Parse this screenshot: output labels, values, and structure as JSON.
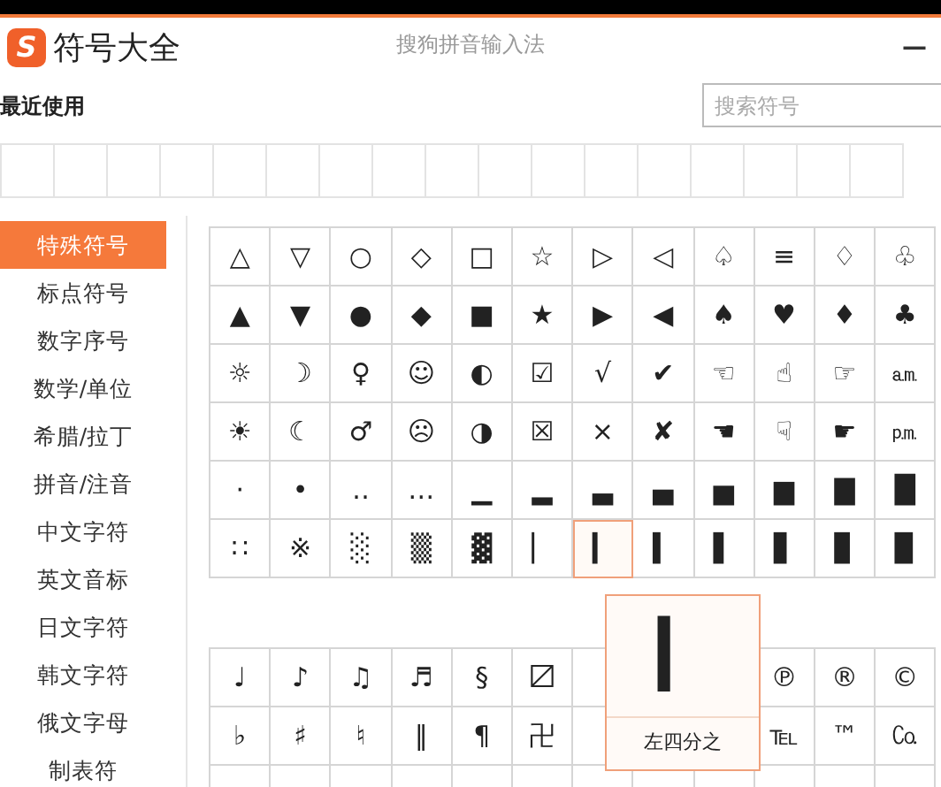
{
  "window": {
    "logo_letter": "S",
    "title": "符号大全",
    "app_name": "搜狗拼音输入法",
    "minimize": "—"
  },
  "recent": {
    "label": "最近使用",
    "search": {
      "placeholder": "搜索符号"
    }
  },
  "sidebar": {
    "items": [
      {
        "label": "特殊符号",
        "selected": true
      },
      {
        "label": "标点符号",
        "selected": false
      },
      {
        "label": "数字序号",
        "selected": false
      },
      {
        "label": "数学/单位",
        "selected": false
      },
      {
        "label": "希腊/拉丁",
        "selected": false
      },
      {
        "label": "拼音/注音",
        "selected": false
      },
      {
        "label": "中文字符",
        "selected": false
      },
      {
        "label": "英文音标",
        "selected": false
      },
      {
        "label": "日文字符",
        "selected": false
      },
      {
        "label": "韩文字符",
        "selected": false
      },
      {
        "label": "俄文字母",
        "selected": false
      },
      {
        "label": "制表符",
        "selected": false
      }
    ]
  },
  "grids": [
    {
      "rows": [
        {
          "cells": [
            {
              "symbol": "△",
              "hovered": false
            },
            {
              "symbol": "▽",
              "hovered": false
            },
            {
              "symbol": "○",
              "hovered": false
            },
            {
              "symbol": "◇",
              "hovered": false
            },
            {
              "symbol": "□",
              "hovered": false
            },
            {
              "symbol": "☆",
              "hovered": false
            },
            {
              "symbol": "▷",
              "hovered": false
            },
            {
              "symbol": "◁",
              "hovered": false
            },
            {
              "symbol": "♤",
              "hovered": false
            },
            {
              "symbol": "≡",
              "hovered": false
            },
            {
              "symbol": "♢",
              "hovered": false
            },
            {
              "symbol": "♧",
              "hovered": false
            }
          ]
        },
        {
          "cells": [
            {
              "symbol": "▲",
              "hovered": false
            },
            {
              "symbol": "▼",
              "hovered": false
            },
            {
              "symbol": "●",
              "hovered": false
            },
            {
              "symbol": "◆",
              "hovered": false
            },
            {
              "symbol": "■",
              "hovered": false
            },
            {
              "symbol": "★",
              "hovered": false
            },
            {
              "symbol": "▶",
              "hovered": false
            },
            {
              "symbol": "◀",
              "hovered": false
            },
            {
              "symbol": "♠",
              "hovered": false
            },
            {
              "symbol": "♥",
              "hovered": false
            },
            {
              "symbol": "♦",
              "hovered": false
            },
            {
              "symbol": "♣",
              "hovered": false
            }
          ]
        },
        {
          "cells": [
            {
              "symbol": "☼",
              "hovered": false
            },
            {
              "symbol": "☽",
              "hovered": false
            },
            {
              "symbol": "♀",
              "hovered": false
            },
            {
              "symbol": "☺",
              "hovered": false
            },
            {
              "symbol": "◐",
              "hovered": false
            },
            {
              "symbol": "☑",
              "hovered": false
            },
            {
              "symbol": "√",
              "hovered": false
            },
            {
              "symbol": "✔",
              "hovered": false
            },
            {
              "symbol": "☜",
              "hovered": false
            },
            {
              "symbol": "☝",
              "hovered": false
            },
            {
              "symbol": "☞",
              "hovered": false
            },
            {
              "symbol": "㏂",
              "hovered": false
            }
          ]
        },
        {
          "cells": [
            {
              "symbol": "☀",
              "hovered": false
            },
            {
              "symbol": "☾",
              "hovered": false
            },
            {
              "symbol": "♂",
              "hovered": false
            },
            {
              "symbol": "☹",
              "hovered": false
            },
            {
              "symbol": "◑",
              "hovered": false
            },
            {
              "symbol": "☒",
              "hovered": false
            },
            {
              "symbol": "×",
              "hovered": false
            },
            {
              "symbol": "✘",
              "hovered": false
            },
            {
              "symbol": "☚",
              "hovered": false
            },
            {
              "symbol": "☟",
              "hovered": false
            },
            {
              "symbol": "☛",
              "hovered": false
            },
            {
              "symbol": "㏘",
              "hovered": false
            }
          ]
        },
        {
          "cells": [
            {
              "symbol": "·",
              "hovered": false
            },
            {
              "symbol": "•",
              "hovered": false
            },
            {
              "symbol": "‥",
              "hovered": false
            },
            {
              "symbol": "…",
              "hovered": false
            },
            {
              "symbol": "▁",
              "hovered": false
            },
            {
              "symbol": "▂",
              "hovered": false
            },
            {
              "symbol": "▃",
              "hovered": false
            },
            {
              "symbol": "▄",
              "hovered": false
            },
            {
              "symbol": "▅",
              "hovered": false
            },
            {
              "symbol": "▆",
              "hovered": false
            },
            {
              "symbol": "▇",
              "hovered": false
            },
            {
              "symbol": "█",
              "hovered": false
            }
          ]
        },
        {
          "cells": [
            {
              "symbol": "∷",
              "hovered": false
            },
            {
              "symbol": "※",
              "hovered": false
            },
            {
              "symbol": "░",
              "hovered": false
            },
            {
              "symbol": "▒",
              "hovered": false
            },
            {
              "symbol": "▓",
              "hovered": false
            },
            {
              "symbol": "▏",
              "hovered": false
            },
            {
              "symbol": "▎",
              "hovered": true
            },
            {
              "symbol": "▍",
              "hovered": false
            },
            {
              "symbol": "▌",
              "hovered": false
            },
            {
              "symbol": "▋",
              "hovered": false
            },
            {
              "symbol": "▊",
              "hovered": false
            },
            {
              "symbol": "▉",
              "hovered": false
            }
          ]
        }
      ]
    },
    {
      "rows": [
        {
          "cells": [
            {
              "symbol": "♩",
              "hovered": false
            },
            {
              "symbol": "♪",
              "hovered": false
            },
            {
              "symbol": "♫",
              "hovered": false
            },
            {
              "symbol": "♬",
              "hovered": false
            },
            {
              "symbol": "§",
              "hovered": false
            },
            {
              "symbol": "〼",
              "hovered": false
            },
            null,
            null,
            null,
            {
              "symbol": "℗",
              "hovered": false
            },
            {
              "symbol": "®",
              "hovered": false
            },
            {
              "symbol": "©",
              "hovered": false
            }
          ]
        },
        {
          "cells": [
            {
              "symbol": "♭",
              "hovered": false
            },
            {
              "symbol": "♯",
              "hovered": false
            },
            {
              "symbol": "♮",
              "hovered": false
            },
            {
              "symbol": "‖",
              "hovered": false
            },
            {
              "symbol": "¶",
              "hovered": false
            },
            {
              "symbol": "卍",
              "hovered": false
            },
            null,
            null,
            null,
            {
              "symbol": "℡",
              "hovered": false
            },
            {
              "symbol": "™",
              "hovered": false
            },
            {
              "symbol": "㏇",
              "hovered": false
            }
          ]
        }
      ]
    }
  ],
  "popup": {
    "symbol": "▎",
    "name": "左四分之"
  }
}
